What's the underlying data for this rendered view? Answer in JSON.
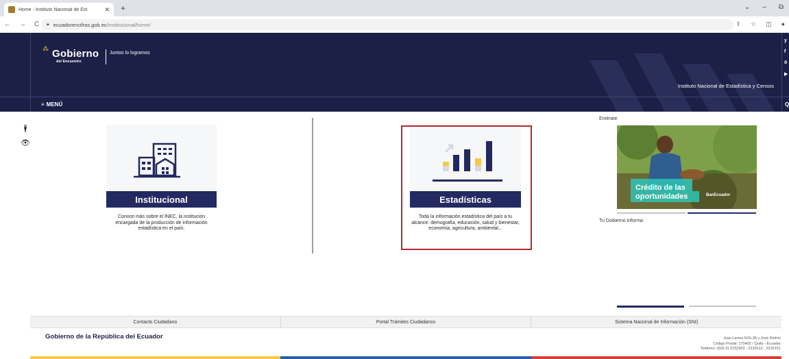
{
  "browser": {
    "tab_title": "Home - Instituto Nacional de Est",
    "tab_close": "✕",
    "new_tab": "+",
    "url_host": "ecuadorencifras.gob.ec",
    "url_path": "/institucional/home/",
    "window_controls": [
      "⌄",
      "–",
      "⧉"
    ]
  },
  "header": {
    "logo_word": "Gobierno",
    "logo_sub": "del Encuentro",
    "slogan": "Juntos lo logramos",
    "institution": "Instituto Nacional de Estadística y Censos",
    "menu_label": "MENÚ",
    "bg_color": "#1c2047"
  },
  "cards": [
    {
      "title": "Institucional",
      "description": "Conoce más sobre el INEC, la institución encargada de la producción de información estadística en el país.",
      "icon": "building-icon"
    },
    {
      "title": "Estadísticas",
      "description": "Toda la información estadística del país a tu alcance: demografía, educación, salud y bienestar, economía, agricultura, ambiental...",
      "icon": "bar-chart-icon"
    }
  ],
  "sidebar": {
    "enterate": "Entérate",
    "banner_text_line1": "Crédito de las",
    "banner_text_line2": "oportunidades",
    "banner_brand": "BanEcuador",
    "tu_gobierno": "Tu Gobierno informa"
  },
  "footer": {
    "links": [
      "Contacto Ciudadano",
      "Portal Trámites Ciudadanos",
      "Sistema Nacional de Información (SNI)"
    ],
    "gov_title": "Gobierno de la República del Ecuador",
    "address_line1": "Juan Larrea N15-36 y José Riofrío",
    "address_line2": "Código Postal: 170402 / Quito - Ecuador",
    "address_line3": "Teléfono: (593-2) 2232303 - 2232012 - 2232151"
  },
  "colors": {
    "navy": "#222a61",
    "highlight_red": "#b4292e",
    "accent_yellow": "#f7c948"
  }
}
